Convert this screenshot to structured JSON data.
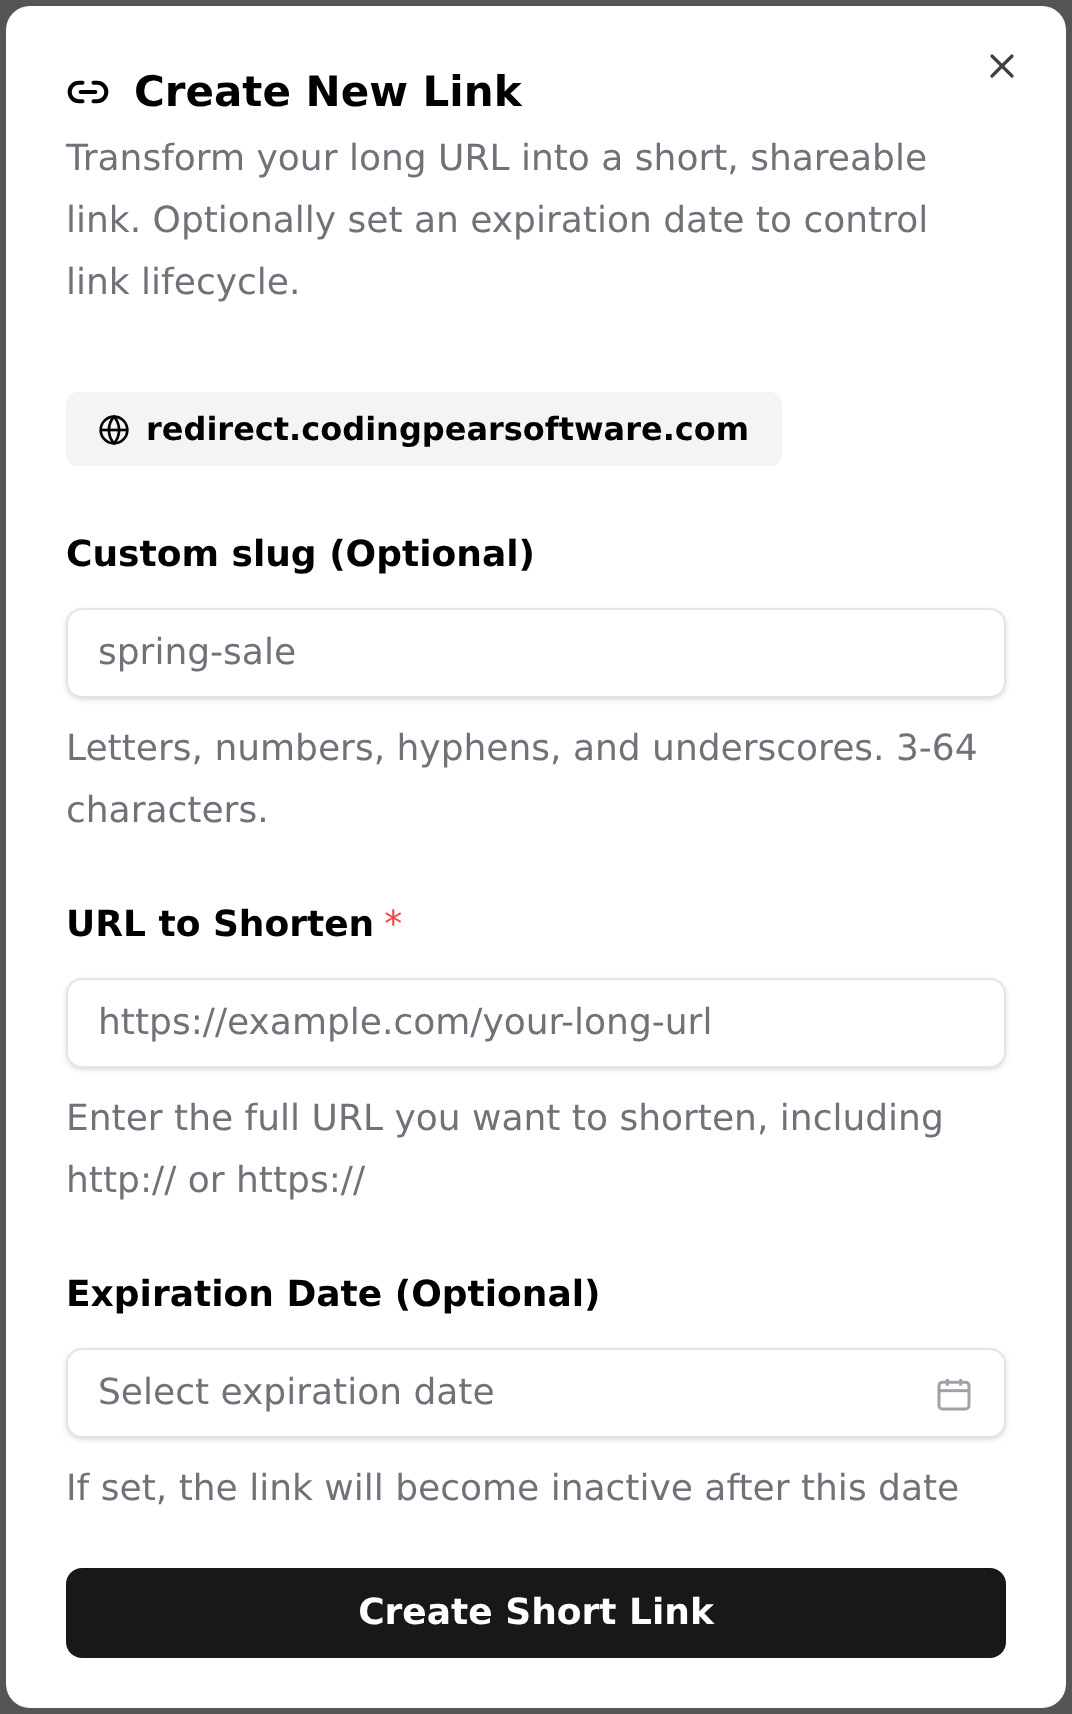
{
  "dialog": {
    "title": "Create New Link",
    "description": "Transform your long URL into a short, shareable link. Optionally set an expiration date to control link lifecycle.",
    "domain": "redirect.codingpearsoftware.com"
  },
  "fields": [
    {
      "kind": "text",
      "label": "Custom slug (Optional)",
      "placeholder": "spring-sale",
      "help": "Letters, numbers, hyphens, and underscores. 3-64 characters."
    },
    {
      "kind": "text",
      "label": "URL to Shorten",
      "required_mark": "*",
      "placeholder": "https://example.com/your-long-url",
      "help": "Enter the full URL you want to shorten, including http:// or https://"
    },
    {
      "kind": "date",
      "label": "Expiration Date (Optional)",
      "placeholder": "Select expiration date",
      "help": "If set, the link will become inactive after this date"
    }
  ],
  "submit": "Create Short Link"
}
